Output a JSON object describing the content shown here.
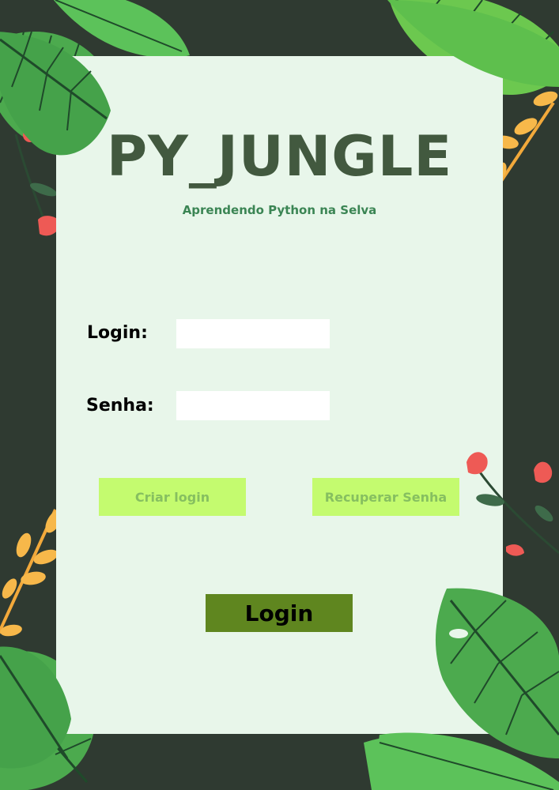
{
  "app": {
    "title": "PY_JUNGLE",
    "subtitle": "Aprendendo Python na Selva"
  },
  "form": {
    "login_label": "Login:",
    "login_value": "",
    "senha_label": "Senha:",
    "senha_value": ""
  },
  "actions": {
    "create_login": "Criar login",
    "recover_password": "Recuperar Senha",
    "login": "Login"
  },
  "colors": {
    "background": "#2f3a31",
    "panel": "#e8f6ea",
    "title": "#42593f",
    "subtitle": "#3b8554",
    "soft_button": "#c4fb6f",
    "login_button": "#5f861f"
  },
  "decorations": [
    "leaf-icon",
    "flower-icon",
    "orange-sprig-icon"
  ]
}
